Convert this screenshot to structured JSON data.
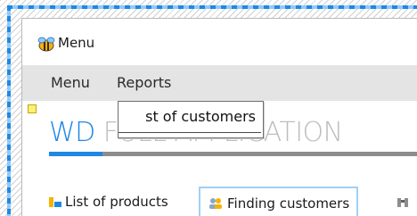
{
  "window": {
    "title": "Menu",
    "icon": "bee-app-icon"
  },
  "menubar": {
    "items": [
      {
        "label": "Menu"
      },
      {
        "label": "Reports"
      }
    ]
  },
  "dropdown": {
    "items": [
      {
        "label": "st of customers"
      }
    ]
  },
  "brand": {
    "strong": "WD",
    "light": " FULL APPLICATION"
  },
  "tabs": [
    {
      "label": "List of products",
      "icon": "products-icon"
    },
    {
      "label": "Finding customers",
      "icon": "customers-icon",
      "active": true
    }
  ],
  "colors": {
    "accent": "#1e88e5",
    "menubar_bg": "#e4e4e4",
    "active_tab_border": "#9fd0f5"
  }
}
